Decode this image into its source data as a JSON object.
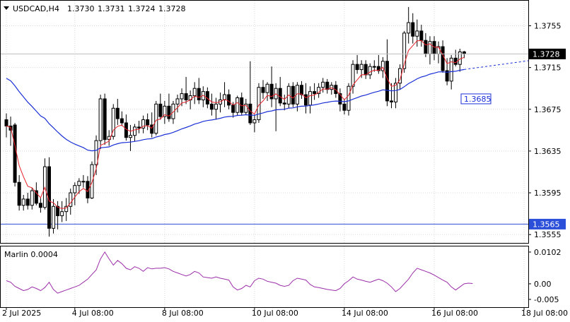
{
  "header": {
    "symbol_timeframe": "USDCAD,H4",
    "ohlc": [
      "1.3730",
      "1.3731",
      "1.3724",
      "1.3728"
    ]
  },
  "indicator": {
    "label": "Marlin 0.0004"
  },
  "price_axis": {
    "ticks": [
      "1.3755",
      "1.3715",
      "1.3675",
      "1.3635",
      "1.3595",
      "1.3555"
    ],
    "tick_values": [
      1.3755,
      1.3715,
      1.3675,
      1.3635,
      1.3595,
      1.3555
    ],
    "current_price": "1.3728",
    "current_price_value": 1.3728,
    "level_line": "1.3565",
    "level_line_value": 1.3565,
    "ma_label": "1.3685",
    "ma_label_value": 1.3685,
    "range": [
      1.3547,
      1.3779
    ]
  },
  "indicator_axis": {
    "ticks": [
      "0.0102",
      "0.00",
      "-0.005"
    ],
    "tick_values": [
      0.0102,
      0.0,
      -0.005
    ],
    "range": [
      -0.0075,
      0.012
    ]
  },
  "time_axis": {
    "labels": [
      "2 Jul 2025",
      "4 Jul 08:00",
      "8 Jul 08:00",
      "10 Jul 08:00",
      "14 Jul 08:00",
      "16 Jul 08:00",
      "18 Jul 08:00"
    ],
    "label_bars": [
      0,
      16,
      37,
      58,
      79,
      100,
      121
    ]
  },
  "colors": {
    "bull": "#ffffff",
    "bear": "#000000",
    "short_ma": "#e8202a",
    "long_ma": "#1b2fd6",
    "level": "#2b4fd8",
    "oscillator": "#9b2fa8",
    "grid": "#d9d9d9",
    "axis": "#000000"
  },
  "chart_data": [
    {
      "type": "candlestick",
      "series_fields": [
        "open",
        "high",
        "low",
        "close"
      ],
      "bars": [
        [
          1.3665,
          1.3671,
          1.3648,
          1.3659
        ],
        [
          1.3659,
          1.3668,
          1.364,
          1.3655
        ],
        [
          1.366,
          1.3662,
          1.3601,
          1.3605
        ],
        [
          1.3605,
          1.3612,
          1.3578,
          1.3583
        ],
        [
          1.3583,
          1.3593,
          1.3578,
          1.3589
        ],
        [
          1.3589,
          1.3595,
          1.3579,
          1.3583
        ],
        [
          1.3583,
          1.36,
          1.3579,
          1.3597
        ],
        [
          1.3597,
          1.3605,
          1.3583,
          1.3585
        ],
        [
          1.3585,
          1.359,
          1.3576,
          1.3581
        ],
        [
          1.3581,
          1.3628,
          1.3579,
          1.362
        ],
        [
          1.362,
          1.3629,
          1.3553,
          1.3561
        ],
        [
          1.3561,
          1.3589,
          1.3556,
          1.3582
        ],
        [
          1.3582,
          1.3587,
          1.356,
          1.3573
        ],
        [
          1.3573,
          1.3587,
          1.3567,
          1.3577
        ],
        [
          1.3577,
          1.359,
          1.3568,
          1.3582
        ],
        [
          1.3582,
          1.3599,
          1.3574,
          1.3595
        ],
        [
          1.3595,
          1.3605,
          1.3583,
          1.3602
        ],
        [
          1.3602,
          1.3609,
          1.3594,
          1.3606
        ],
        [
          1.3606,
          1.3612,
          1.36,
          1.3606
        ],
        [
          1.3606,
          1.3611,
          1.3585,
          1.359
        ],
        [
          1.359,
          1.3625,
          1.3589,
          1.3622
        ],
        [
          1.3622,
          1.365,
          1.3612,
          1.3645
        ],
        [
          1.3645,
          1.3689,
          1.3637,
          1.3685
        ],
        [
          1.3685,
          1.369,
          1.3641,
          1.3646
        ],
        [
          1.3646,
          1.3655,
          1.364,
          1.3649
        ],
        [
          1.3649,
          1.368,
          1.3646,
          1.3676
        ],
        [
          1.3676,
          1.3685,
          1.366,
          1.3666
        ],
        [
          1.3666,
          1.3673,
          1.3659,
          1.3662
        ],
        [
          1.3662,
          1.367,
          1.3645,
          1.3648
        ],
        [
          1.3648,
          1.366,
          1.3635,
          1.365
        ],
        [
          1.365,
          1.3661,
          1.3644,
          1.3658
        ],
        [
          1.3658,
          1.3664,
          1.3652,
          1.3657
        ],
        [
          1.3657,
          1.3669,
          1.3652,
          1.3665
        ],
        [
          1.3665,
          1.3671,
          1.3655,
          1.366
        ],
        [
          1.366,
          1.3672,
          1.3648,
          1.3652
        ],
        [
          1.3652,
          1.3683,
          1.365,
          1.368
        ],
        [
          1.368,
          1.369,
          1.3665,
          1.3668
        ],
        [
          1.3668,
          1.3683,
          1.3661,
          1.3678
        ],
        [
          1.3678,
          1.369,
          1.3663,
          1.3666
        ],
        [
          1.3666,
          1.3683,
          1.3661,
          1.368
        ],
        [
          1.368,
          1.3689,
          1.3672,
          1.3685
        ],
        [
          1.3685,
          1.3695,
          1.3678,
          1.369
        ],
        [
          1.369,
          1.3706,
          1.368,
          1.3684
        ],
        [
          1.3684,
          1.3693,
          1.3675,
          1.3688
        ],
        [
          1.3688,
          1.3701,
          1.368,
          1.3695
        ],
        [
          1.3695,
          1.3705,
          1.368,
          1.3684
        ],
        [
          1.3684,
          1.3697,
          1.3677,
          1.3692
        ],
        [
          1.3692,
          1.3696,
          1.3676,
          1.368
        ],
        [
          1.368,
          1.369,
          1.3669,
          1.3675
        ],
        [
          1.3675,
          1.3686,
          1.3665,
          1.368
        ],
        [
          1.368,
          1.3691,
          1.3672,
          1.3684
        ],
        [
          1.3684,
          1.3701,
          1.3677,
          1.3689
        ],
        [
          1.3689,
          1.3694,
          1.3675,
          1.3679
        ],
        [
          1.3679,
          1.3682,
          1.3667,
          1.3672
        ],
        [
          1.3672,
          1.3688,
          1.3669,
          1.3686
        ],
        [
          1.3686,
          1.3691,
          1.3669,
          1.3672
        ],
        [
          1.3672,
          1.3685,
          1.367,
          1.368
        ],
        [
          1.368,
          1.3721,
          1.366,
          1.3662
        ],
        [
          1.3662,
          1.367,
          1.3653,
          1.3665
        ],
        [
          1.3665,
          1.37,
          1.3662,
          1.3696
        ],
        [
          1.3696,
          1.3703,
          1.3685,
          1.3691
        ],
        [
          1.3691,
          1.3701,
          1.3683,
          1.3699
        ],
        [
          1.3699,
          1.3716,
          1.3677,
          1.3685
        ],
        [
          1.3685,
          1.37,
          1.3654,
          1.3695
        ],
        [
          1.3695,
          1.3706,
          1.3678,
          1.3681
        ],
        [
          1.3681,
          1.3689,
          1.3674,
          1.368
        ],
        [
          1.368,
          1.37,
          1.3676,
          1.3697
        ],
        [
          1.3697,
          1.3701,
          1.3677,
          1.368
        ],
        [
          1.368,
          1.3701,
          1.3673,
          1.3698
        ],
        [
          1.3698,
          1.3702,
          1.3685,
          1.3689
        ],
        [
          1.3689,
          1.37,
          1.3671,
          1.3679
        ],
        [
          1.3679,
          1.3697,
          1.3671,
          1.3692
        ],
        [
          1.3692,
          1.37,
          1.3684,
          1.369
        ],
        [
          1.369,
          1.37,
          1.3686,
          1.3696
        ],
        [
          1.3696,
          1.3705,
          1.3691,
          1.3701
        ],
        [
          1.3701,
          1.3704,
          1.369,
          1.3694
        ],
        [
          1.3694,
          1.3701,
          1.3689,
          1.3698
        ],
        [
          1.3698,
          1.3702,
          1.3686,
          1.369
        ],
        [
          1.369,
          1.3695,
          1.3673,
          1.368
        ],
        [
          1.368,
          1.3685,
          1.367,
          1.3674
        ],
        [
          1.3674,
          1.37,
          1.3669,
          1.3697
        ],
        [
          1.3697,
          1.3722,
          1.369,
          1.3718
        ],
        [
          1.3718,
          1.3727,
          1.3709,
          1.3713
        ],
        [
          1.3713,
          1.3722,
          1.3705,
          1.3718
        ],
        [
          1.3718,
          1.3722,
          1.3704,
          1.3708
        ],
        [
          1.3708,
          1.3719,
          1.3704,
          1.3716
        ],
        [
          1.3716,
          1.3722,
          1.3711,
          1.3716
        ],
        [
          1.3716,
          1.3727,
          1.3709,
          1.3712
        ],
        [
          1.3712,
          1.3725,
          1.3705,
          1.3721
        ],
        [
          1.3721,
          1.3742,
          1.3678,
          1.3683
        ],
        [
          1.3683,
          1.37,
          1.3676,
          1.3682
        ],
        [
          1.3682,
          1.3705,
          1.3676,
          1.37
        ],
        [
          1.37,
          1.3718,
          1.3694,
          1.3714
        ],
        [
          1.3714,
          1.375,
          1.371,
          1.3748
        ],
        [
          1.3748,
          1.3773,
          1.3738,
          1.3758
        ],
        [
          1.3758,
          1.3767,
          1.3738,
          1.3745
        ],
        [
          1.3745,
          1.3761,
          1.3735,
          1.375
        ],
        [
          1.375,
          1.3756,
          1.3735,
          1.3741
        ],
        [
          1.3741,
          1.3748,
          1.3725,
          1.3728
        ],
        [
          1.3728,
          1.3745,
          1.3718,
          1.374
        ],
        [
          1.374,
          1.3745,
          1.3722,
          1.3728
        ],
        [
          1.3728,
          1.374,
          1.3719,
          1.3735
        ],
        [
          1.3735,
          1.3741,
          1.371,
          1.3712
        ],
        [
          1.3712,
          1.3724,
          1.3698,
          1.3702
        ],
        [
          1.3702,
          1.3727,
          1.3694,
          1.3724
        ],
        [
          1.3724,
          1.3732,
          1.3716,
          1.3718
        ],
        [
          1.3718,
          1.3733,
          1.3711,
          1.373
        ],
        [
          1.373,
          1.3731,
          1.3724,
          1.3728
        ]
      ]
    },
    {
      "type": "line",
      "role": "oscillator",
      "values": [
        0.001,
        0.0005,
        -0.0008,
        -0.0015,
        -0.0022,
        -0.0018,
        -0.001,
        -0.0015,
        -0.0022,
        -0.0012,
        0.0005,
        -0.0018,
        -0.003,
        -0.0025,
        -0.002,
        -0.0015,
        -0.001,
        -0.0005,
        0.0005,
        0.0015,
        0.003,
        0.0045,
        0.008,
        0.0102,
        0.008,
        0.006,
        0.0075,
        0.0065,
        0.005,
        0.0045,
        0.0055,
        0.005,
        0.004,
        0.0052,
        0.0048,
        0.005,
        0.005,
        0.0052,
        0.0048,
        0.004,
        0.0035,
        0.003,
        0.0025,
        0.003,
        0.004,
        0.0035,
        0.0022,
        0.002,
        0.0018,
        0.0022,
        0.0018,
        0.0015,
        0.0012,
        -0.001,
        -0.002,
        -0.0015,
        -0.0005,
        -0.001,
        0.001,
        0.0018,
        0.0015,
        0.0008,
        0.0005,
        0.0002,
        -0.0005,
        -0.0008,
        -0.0005,
        0.001,
        0.0018,
        0.0015,
        0.0012,
        -0.0002,
        -0.001,
        -0.0012,
        -0.0015,
        -0.0018,
        -0.002,
        -0.0022,
        -0.0015,
        0.0,
        0.001,
        0.0022,
        0.0015,
        0.0012,
        0.0008,
        0.0005,
        0.001,
        0.0015,
        0.001,
        0.0002,
        -0.001,
        -0.0025,
        -0.0015,
        0.0,
        0.0015,
        0.0035,
        0.005,
        0.0045,
        0.004,
        0.0035,
        0.0028,
        0.002,
        0.0012,
        0.0005,
        -0.001,
        -0.002,
        -0.001,
        0.0,
        0.0002,
        0.0001
      ]
    }
  ]
}
